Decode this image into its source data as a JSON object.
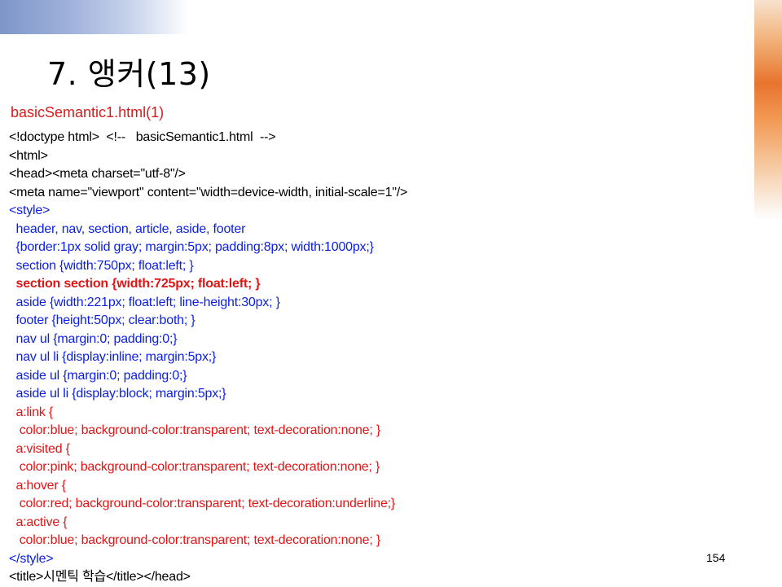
{
  "slide": {
    "title": "7. 앵커(13)",
    "subtitle": "basicSemantic1.html(1)",
    "page_number": "154"
  },
  "code_lines": [
    {
      "text": "<!doctype html>  <!--   basicSemantic1.html  -->",
      "color": "black",
      "bold": false
    },
    {
      "text": "<html>",
      "color": "black",
      "bold": false
    },
    {
      "text": "<head><meta charset=\"utf-8\"/>",
      "color": "black",
      "bold": false
    },
    {
      "text": "<meta name=\"viewport\" content=\"width=device-width, initial-scale=1\"/>",
      "color": "black",
      "bold": false
    },
    {
      "text": "<style>",
      "color": "blue",
      "bold": false
    },
    {
      "text": "  header, nav, section, article, aside, footer",
      "color": "blue",
      "bold": false
    },
    {
      "text": "  {border:1px solid gray; margin:5px; padding:8px; width:1000px;}",
      "color": "blue",
      "bold": false
    },
    {
      "text": "  section {width:750px; float:left; }",
      "color": "blue",
      "bold": false
    },
    {
      "text": "  section section {width:725px; float:left; }",
      "color": "red",
      "bold": true
    },
    {
      "text": "  aside {width:221px; float:left; line-height:30px; }",
      "color": "blue",
      "bold": false
    },
    {
      "text": "  footer {height:50px; clear:both; }",
      "color": "blue",
      "bold": false
    },
    {
      "text": "  nav ul {margin:0; padding:0;}",
      "color": "blue",
      "bold": false
    },
    {
      "text": "  nav ul li {display:inline; margin:5px;}",
      "color": "blue",
      "bold": false
    },
    {
      "text": "  aside ul {margin:0; padding:0;}",
      "color": "blue",
      "bold": false
    },
    {
      "text": "  aside ul li {display:block; margin:5px;}",
      "color": "blue",
      "bold": false
    },
    {
      "text": "  a:link {",
      "color": "red",
      "bold": false
    },
    {
      "text": "   color:blue; background-color:transparent; text-decoration:none; }",
      "color": "red",
      "bold": false
    },
    {
      "text": "  a:visited {",
      "color": "red",
      "bold": false
    },
    {
      "text": "   color:pink; background-color:transparent; text-decoration:none; }",
      "color": "red",
      "bold": false
    },
    {
      "text": "  a:hover {",
      "color": "red",
      "bold": false
    },
    {
      "text": "   color:red; background-color:transparent; text-decoration:underline;}",
      "color": "red",
      "bold": false
    },
    {
      "text": "  a:active {",
      "color": "red",
      "bold": false
    },
    {
      "text": "   color:blue; background-color:transparent; text-decoration:none; }",
      "color": "red",
      "bold": false
    },
    {
      "text": "</style>",
      "color": "blue",
      "bold": false
    },
    {
      "text": "<title>시멘틱 학습</title></head>",
      "color": "black",
      "bold": false
    }
  ],
  "colors": {
    "black": "#000000",
    "blue": "#0a1ee6",
    "red": "#e01515",
    "subtitle": "#d81b1b"
  }
}
